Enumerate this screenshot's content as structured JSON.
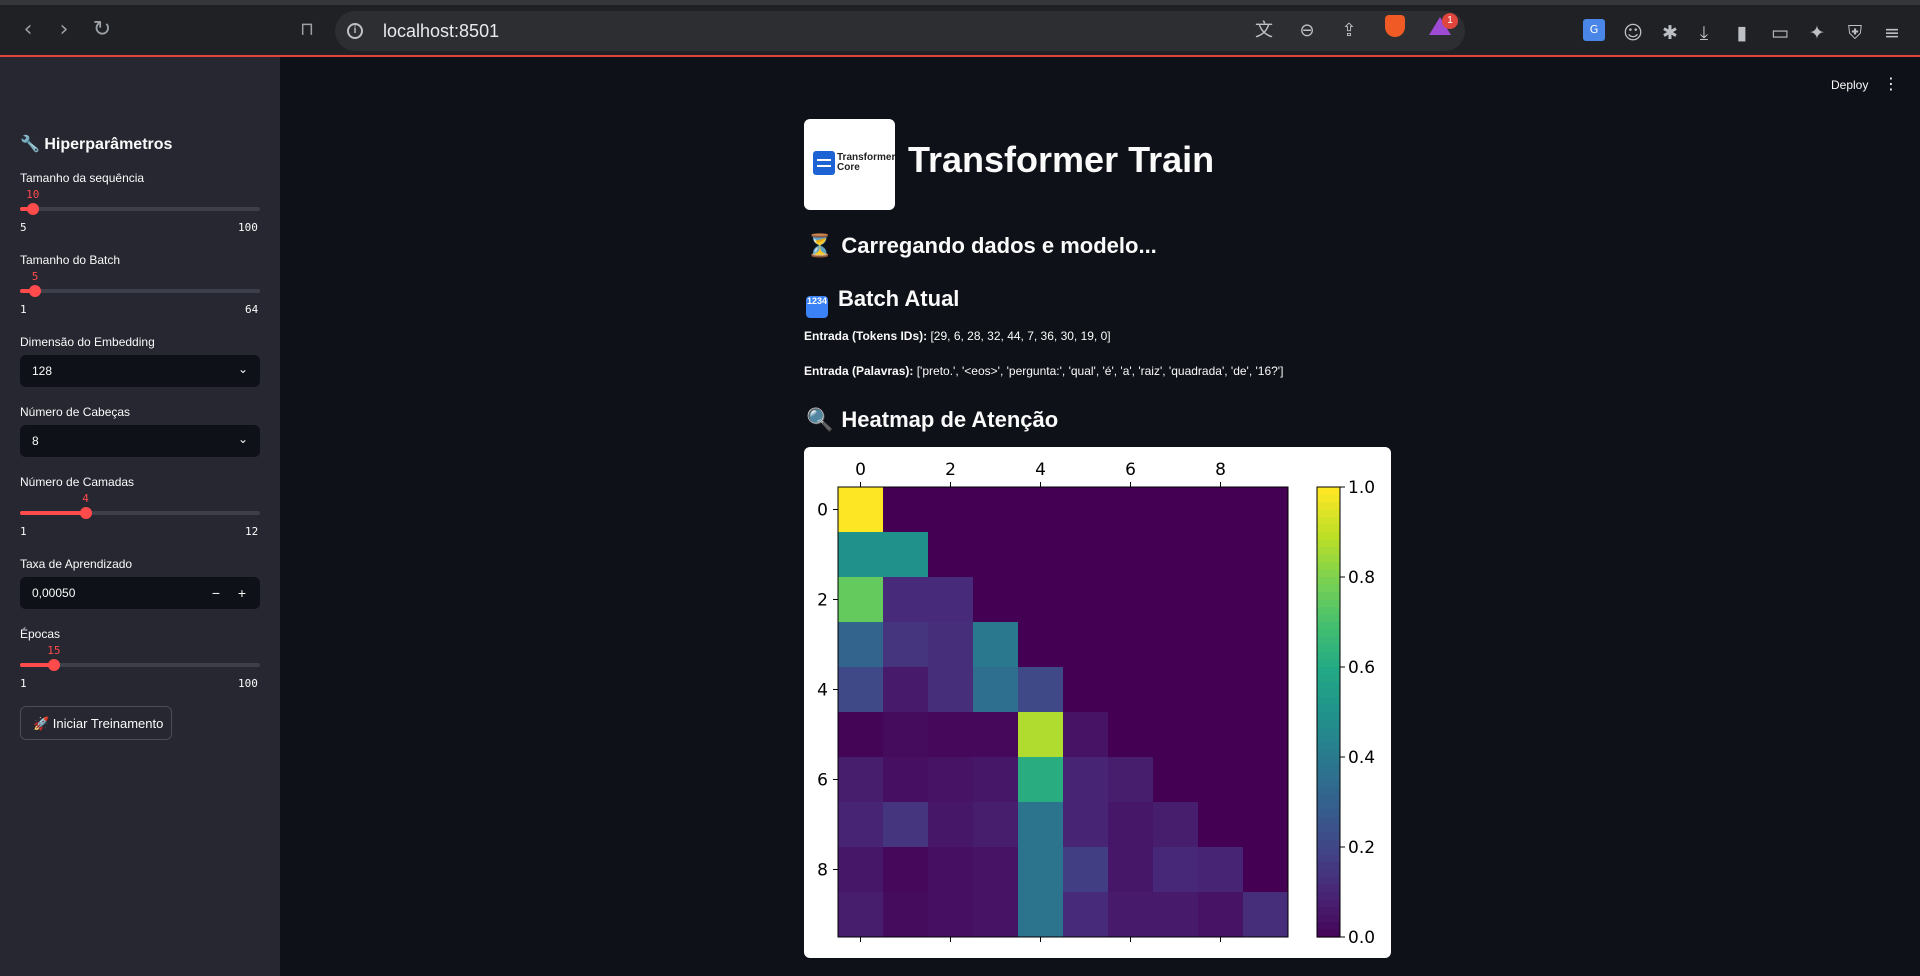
{
  "browser": {
    "url": "localhost:8501",
    "rewards_badge": "1",
    "back_icon": "back-arrow-icon",
    "forward_icon": "forward-arrow-icon",
    "reload_icon": "reload-icon"
  },
  "sidebar": {
    "title": "🔧 Hiperparâmetros",
    "seq_len": {
      "label": "Tamanho da sequência",
      "value": "10",
      "min": "5",
      "max": "100",
      "fraction": 0.053
    },
    "batch": {
      "label": "Tamanho do Batch",
      "value": "5",
      "min": "1",
      "max": "64",
      "fraction": 0.063
    },
    "embedding": {
      "label": "Dimensão do Embedding",
      "value": "128"
    },
    "heads": {
      "label": "Número de Cabeças",
      "value": "8"
    },
    "layers": {
      "label": "Número de Camadas",
      "value": "4",
      "min": "1",
      "max": "12",
      "fraction": 0.273
    },
    "lr": {
      "label": "Taxa de Aprendizado",
      "value": "0,00050",
      "minus": "−",
      "plus": "+"
    },
    "epochs": {
      "label": "Épocas",
      "value": "15",
      "min": "1",
      "max": "100",
      "fraction": 0.141
    },
    "train_button": "🚀 Iniciar Treinamento"
  },
  "header": {
    "deploy": "Deploy",
    "logo_text_1": "Transformer",
    "logo_text_2": "Core",
    "title": "Transformer Train"
  },
  "content": {
    "loading_icon": "⏳",
    "loading": "Carregando dados e modelo...",
    "batch_icon": "1234",
    "batch_heading": "Batch Atual",
    "input_ids_label": "Entrada (Tokens IDs):",
    "input_ids_value": " [29, 6, 28, 32, 44, 7, 36, 30, 19, 0]",
    "input_words_label": "Entrada (Palavras):",
    "input_words_value": " ['preto.', '<eos>', 'pergunta:', 'qual', 'é', 'a', 'raiz', 'quadrada', 'de', '16?']",
    "heatmap_icon": "🔍",
    "heatmap_heading": "Heatmap de Atenção"
  },
  "chart_data": {
    "type": "heatmap",
    "colormap": "viridis",
    "vmin": 0.0,
    "vmax": 1.0,
    "x_ticks": [
      "0",
      "2",
      "4",
      "6",
      "8"
    ],
    "y_ticks": [
      "0",
      "2",
      "4",
      "6",
      "8"
    ],
    "colorbar_ticks": [
      "0.0",
      "0.2",
      "0.4",
      "0.6",
      "0.8",
      "1.0"
    ],
    "matrix": [
      [
        1.0,
        0,
        0,
        0,
        0,
        0,
        0,
        0,
        0,
        0
      ],
      [
        0.5,
        0.5,
        0,
        0,
        0,
        0,
        0,
        0,
        0,
        0
      ],
      [
        0.76,
        0.12,
        0.12,
        0,
        0,
        0,
        0,
        0,
        0,
        0
      ],
      [
        0.32,
        0.15,
        0.13,
        0.4,
        0,
        0,
        0,
        0,
        0,
        0
      ],
      [
        0.22,
        0.07,
        0.13,
        0.36,
        0.22,
        0,
        0,
        0,
        0,
        0
      ],
      [
        0.01,
        0.03,
        0.02,
        0.02,
        0.88,
        0.05,
        0,
        0,
        0,
        0
      ],
      [
        0.08,
        0.04,
        0.05,
        0.06,
        0.62,
        0.1,
        0.08,
        0,
        0,
        0
      ],
      [
        0.1,
        0.15,
        0.06,
        0.08,
        0.38,
        0.1,
        0.06,
        0.08,
        0,
        0
      ],
      [
        0.06,
        0.02,
        0.04,
        0.05,
        0.38,
        0.18,
        0.06,
        0.11,
        0.1,
        0
      ],
      [
        0.08,
        0.03,
        0.04,
        0.05,
        0.38,
        0.12,
        0.07,
        0.07,
        0.05,
        0.13
      ]
    ]
  }
}
